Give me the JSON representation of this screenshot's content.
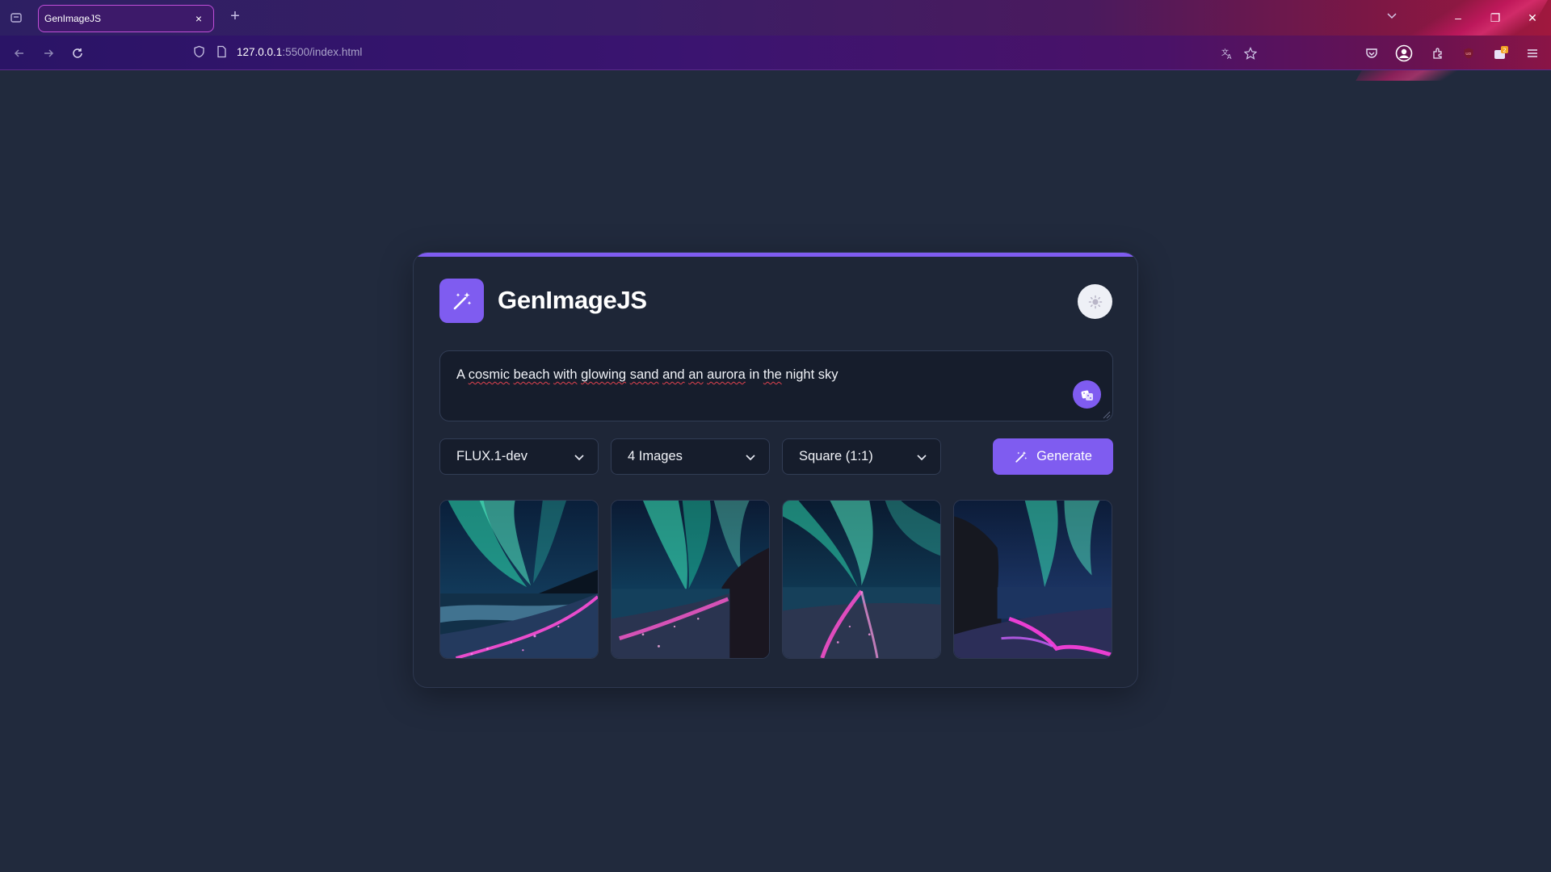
{
  "browser": {
    "tab": {
      "title": "GenImageJS",
      "close_icon": "×"
    },
    "new_tab_icon": "+",
    "address": {
      "host": "127.0.0.1",
      "rest": ":5500/index.html"
    },
    "window_controls": {
      "minimize": "–",
      "restore": "❐",
      "close": "✕"
    },
    "profile_badge": "2"
  },
  "app": {
    "title": "GenImageJS",
    "accent_color": "#7f5cf0",
    "prompt": {
      "text_parts": [
        "A ",
        "cosmic",
        " ",
        "beach",
        " ",
        "with",
        " ",
        "glowing",
        " ",
        "sand",
        " ",
        "and",
        " ",
        "an",
        " ",
        "aurora",
        " ",
        "in",
        " ",
        "the",
        " ",
        "night",
        " ",
        "sky"
      ]
    },
    "controls": {
      "model": "FLUX.1-dev",
      "count": "4 Images",
      "ratio": "Square (1:1)",
      "generate_label": "Generate"
    },
    "gallery": [
      {
        "name": "Generated image 1",
        "variant": "shore-right"
      },
      {
        "name": "Generated image 2",
        "variant": "cliff-right"
      },
      {
        "name": "Generated image 3",
        "variant": "center-path"
      },
      {
        "name": "Generated image 4",
        "variant": "cliff-left"
      }
    ]
  }
}
